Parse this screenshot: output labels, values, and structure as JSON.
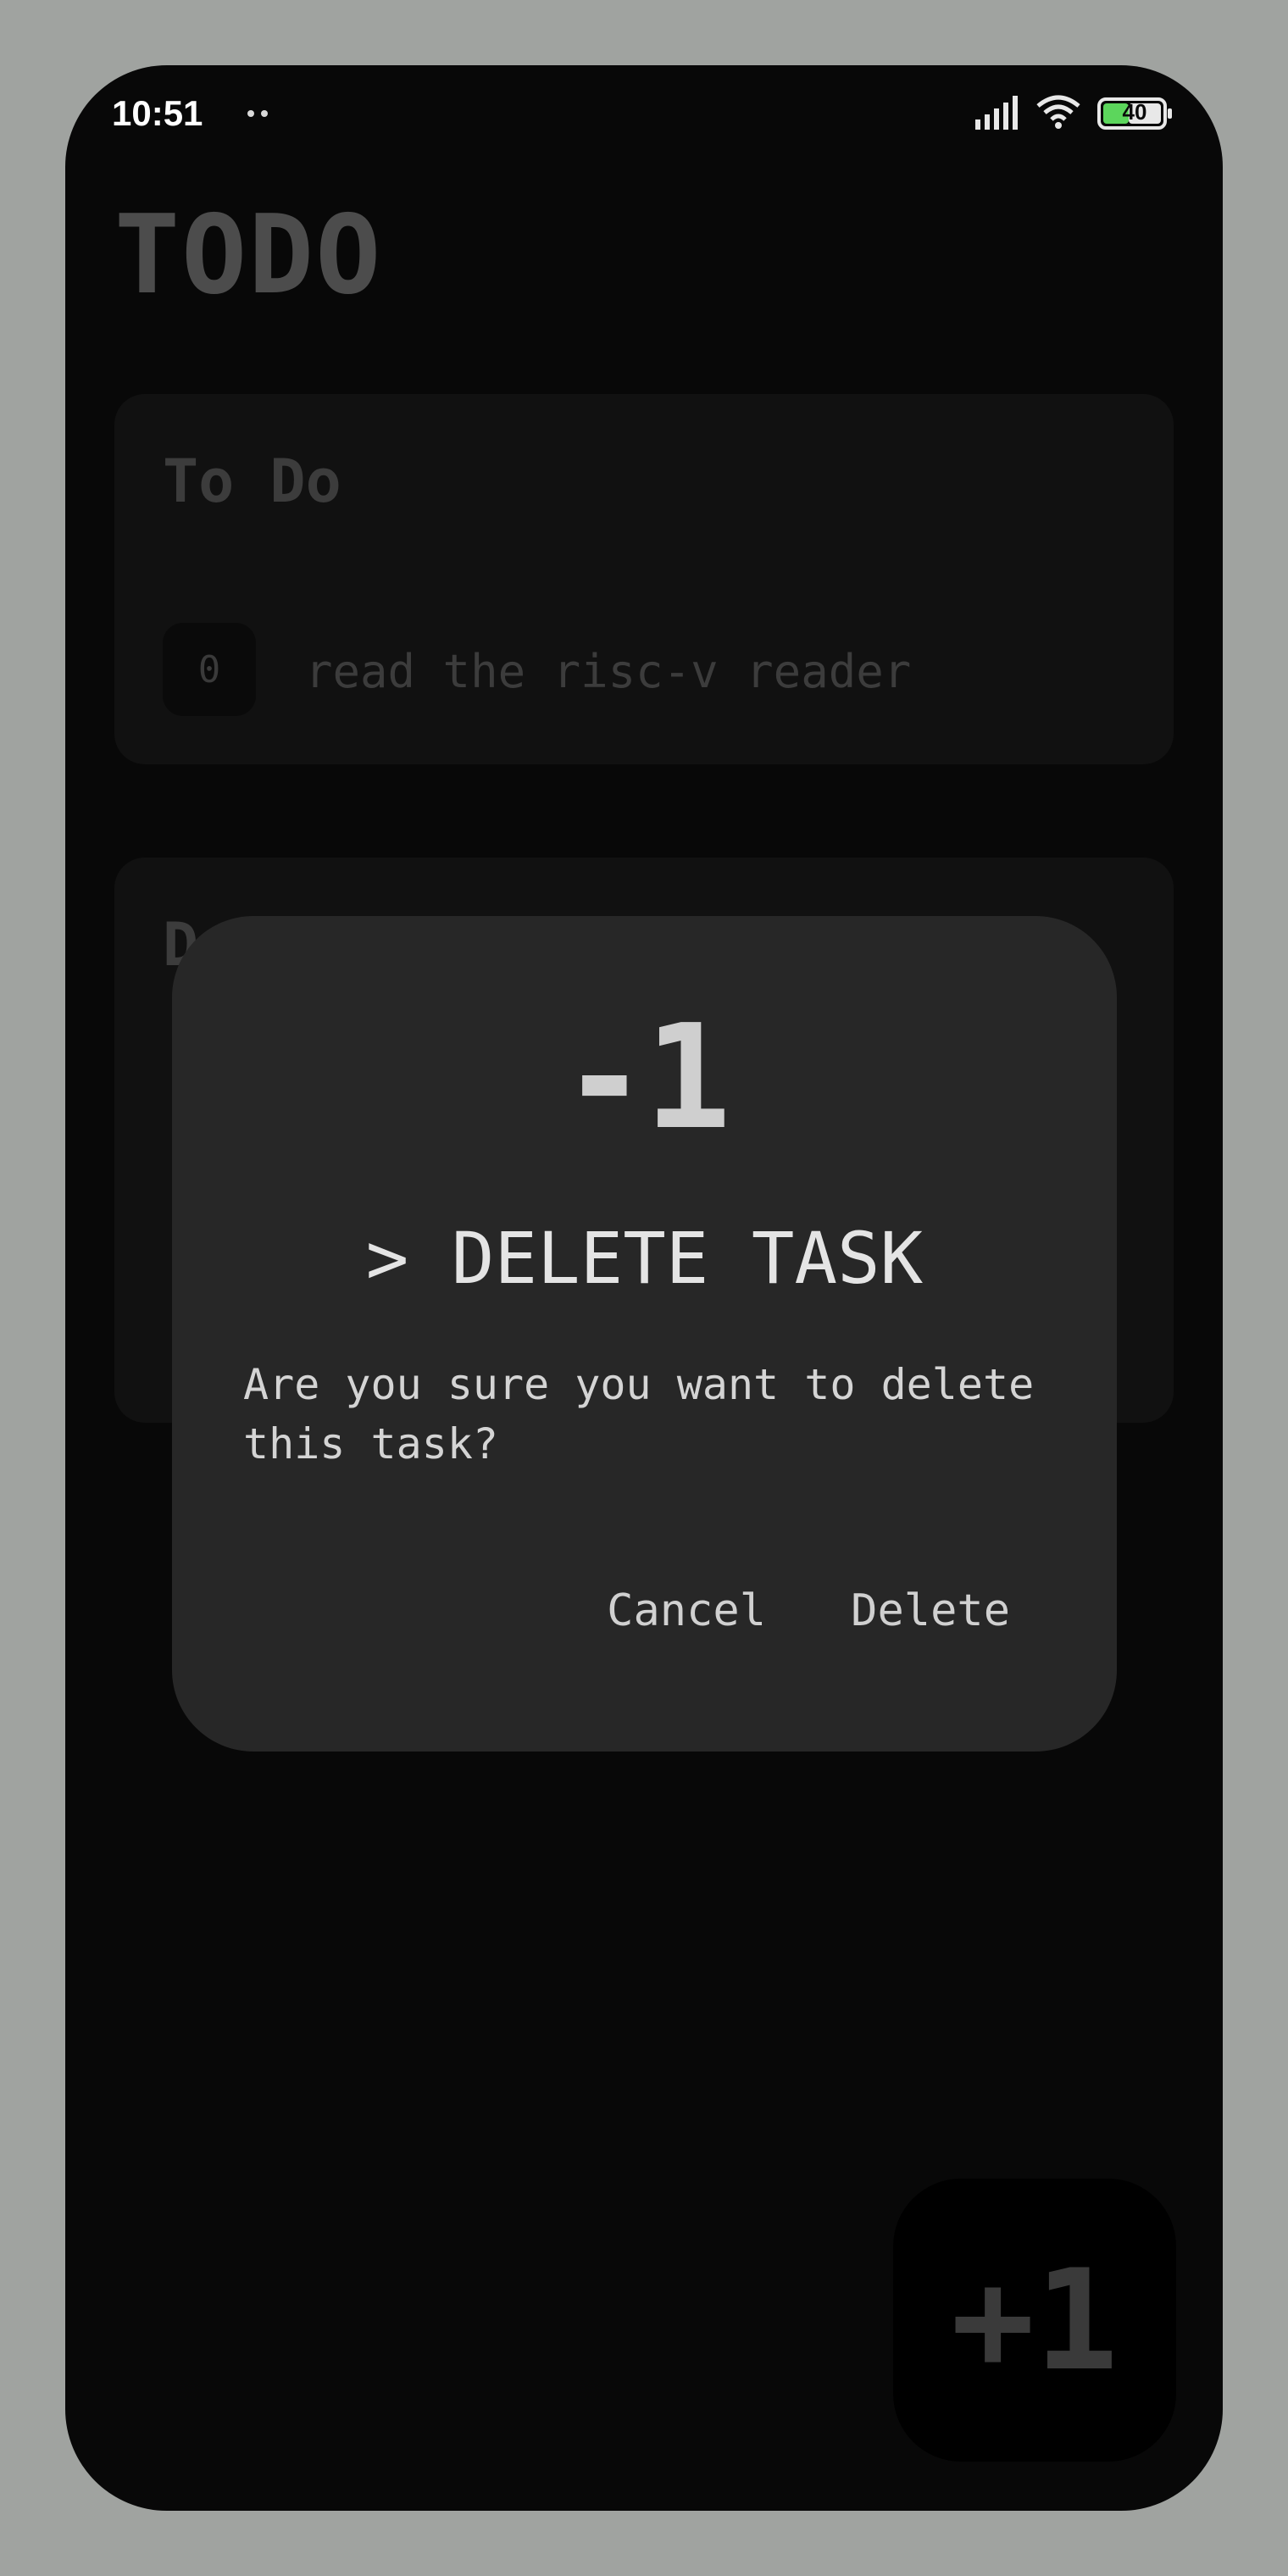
{
  "status_bar": {
    "time": "10:51",
    "battery_level": "40",
    "signal_icon": "cellular-signal-icon",
    "wifi_icon": "wifi-icon",
    "battery_icon": "battery-icon"
  },
  "app": {
    "title": "TODO"
  },
  "todo_section": {
    "title": "To Do",
    "tasks": [
      {
        "id": "0",
        "text": "read the risc-v reader"
      }
    ]
  },
  "done_section": {
    "title": "D"
  },
  "fab": {
    "label": "+1"
  },
  "dialog": {
    "icon_text": "-1",
    "title": "> DELETE TASK",
    "message": "Are you sure you want to delete this task?",
    "cancel_label": "Cancel",
    "delete_label": "Delete"
  },
  "colors": {
    "background": "#080808",
    "dialog_bg": "#272727",
    "text_dim": "#3c3c3c",
    "text_bright": "#e4e4e4"
  }
}
